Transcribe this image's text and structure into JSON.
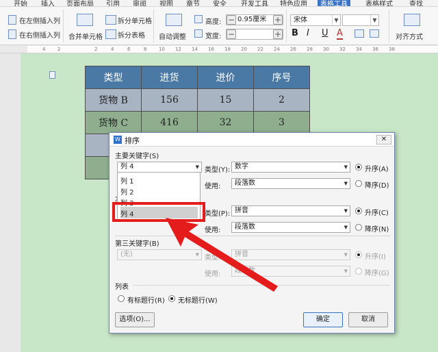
{
  "menu_tabs": [
    "开始",
    "插入",
    "页面布局",
    "引用",
    "审阅",
    "视图",
    "章节",
    "安全",
    "开发工具",
    "特色应用",
    "表格工具",
    "表格样式",
    "查找"
  ],
  "active_tab": "表格工具",
  "ribbon": {
    "insert_left": "在左侧插入列",
    "insert_right": "在右侧插入列",
    "merge_cells": "合并单元格",
    "split_cells": "拆分单元格",
    "split_table": "拆分表格",
    "auto_fit": "自动调整",
    "height_label": "高度:",
    "height_value": "0.95厘米",
    "width_label": "宽度:",
    "width_value": "",
    "font_name": "宋体",
    "bold": "B",
    "italic": "I",
    "underline": "U",
    "font_color": "A",
    "align_label": "对齐方式"
  },
  "ruler_ticks": [
    "4",
    "2",
    "2",
    "4",
    "6",
    "8",
    "10",
    "12",
    "14",
    "16",
    "18",
    "20",
    "22",
    "24",
    "26",
    "28",
    "30",
    "32",
    "34",
    "36",
    "38"
  ],
  "table": {
    "headers": [
      "类型",
      "进货",
      "进价",
      "序号"
    ],
    "rows": [
      [
        "货物 B",
        "156",
        "15",
        "2"
      ],
      [
        "货物 C",
        "416",
        "32",
        "3"
      ],
      [
        "货",
        "",
        "",
        ""
      ],
      [
        "货",
        "",
        "",
        ""
      ]
    ]
  },
  "dialog": {
    "title": "排序",
    "primary_key_label": "主要关键字(S)",
    "primary_key_value": "列 4",
    "type_label_y": "类型(Y):",
    "type_value_1": "数字",
    "use_label": "使用:",
    "use_value": "段落数",
    "asc_a": "升序(A)",
    "desc_d": "降序(D)",
    "secondary_key_label": "次",
    "type_label_p": "类型(P):",
    "type_value_2": "拼音",
    "asc_c": "升序(C)",
    "desc_n": "降序(N)",
    "third_key_label": "第三关键字(B)",
    "third_key_value": "(无)",
    "type_label_3": "类型:",
    "type_value_3": "拼音",
    "use_value_3": "段落数",
    "asc_i": "升序(I)",
    "desc_g": "降序(G)",
    "list_label": "列表",
    "has_header": "有标题行(R)",
    "no_header": "无标题行(W)",
    "options_button": "选项(O)...",
    "ok_button": "确定",
    "cancel_button": "取消",
    "close_glyph": "✕"
  },
  "dropdown_items": [
    "列 1",
    "列 2",
    "列 3",
    "列 4"
  ],
  "colors": {
    "page_bg": "#c8e6c8",
    "header_row": "#4a79a6",
    "highlight_box": "#e51c1c",
    "active_tab": "#3a74c4"
  }
}
